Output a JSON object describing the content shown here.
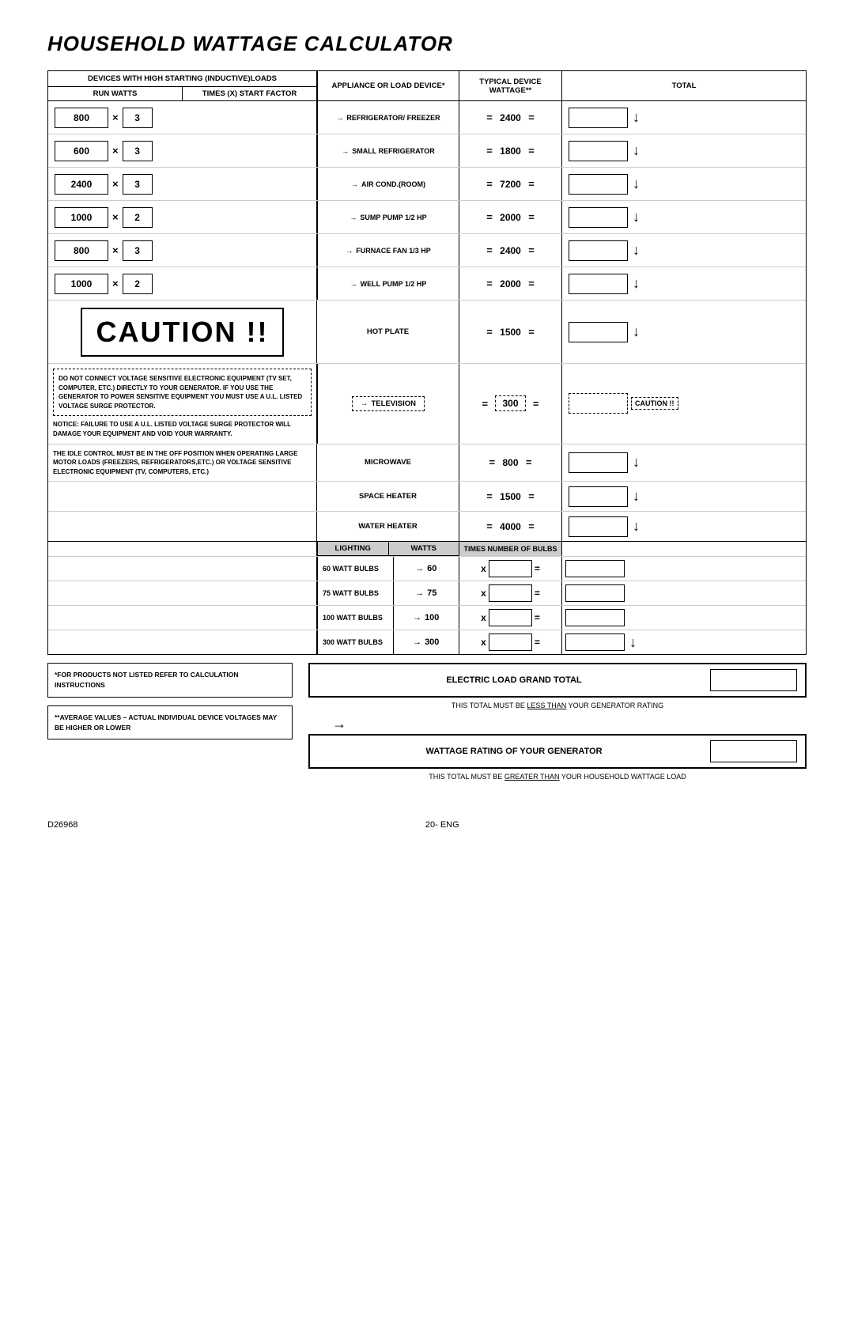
{
  "title": "HOUSEHOLD WATTAGE CALCULATOR",
  "headers": {
    "devices": "DEVICES WITH HIGH STARTING (INDUCTIVE)LOADS",
    "run_watts": "RUN WATTS",
    "start_factor": "TIMES (X) START FACTOR",
    "appliance": "APPLIANCE OR LOAD DEVICE*",
    "wattage": "TYPICAL DEVICE WATTAGE**",
    "total": "TOTAL"
  },
  "rows": [
    {
      "run_watts": "800",
      "start_factor": "3",
      "appliance": "REFRIGERATOR/ FREEZER",
      "wattage": "2400"
    },
    {
      "run_watts": "600",
      "start_factor": "3",
      "appliance": "SMALL REFRIGERATOR",
      "wattage": "1800"
    },
    {
      "run_watts": "2400",
      "start_factor": "3",
      "appliance": "AIR COND.(ROOM)",
      "wattage": "7200"
    },
    {
      "run_watts": "1000",
      "start_factor": "2",
      "appliance": "SUMP PUMP 1/2 HP",
      "wattage": "2000"
    },
    {
      "run_watts": "800",
      "start_factor": "3",
      "appliance": "FURNACE FAN 1/3 HP",
      "wattage": "2400"
    },
    {
      "run_watts": "1000",
      "start_factor": "2",
      "appliance": "WELL PUMP 1/2 HP",
      "wattage": "2000"
    }
  ],
  "caution_big": "CAUTION !!",
  "caution_text": "DO NOT CONNECT VOLTAGE SENSITIVE ELECTRONIC EQUIPMENT (TV SET, COMPUTER, ETC.) DIRECTLY TO YOUR GENERATOR. IF YOU USE THE GENERATOR TO POWER SENSITIVE EQUIPMENT YOU MUST USE A U.L. LISTED VOLTAGE SURGE PROTECTOR.",
  "notice_text": "NOTICE: FAILURE TO USE A U.L. LISTED VOLTAGE SURGE PROTECTOR WILL DAMAGE YOUR EQUIPMENT AND VOID YOUR WARRANTY.",
  "idle_text": "THE IDLE CONTROL MUST BE IN THE OFF POSITION WHEN OPERATING LARGE MOTOR LOADS (FREEZERS, REFRIGERATORS,ETC.) OR VOLTAGE SENSITIVE ELECTRONIC EQUIPMENT (TV, COMPUTERS, ETC.)",
  "non_inductive_rows": [
    {
      "appliance": "HOT PLATE",
      "wattage": "1500"
    },
    {
      "appliance": "TELEVISION",
      "wattage": "300",
      "dashed": true
    },
    {
      "appliance": "MICROWAVE",
      "wattage": "800"
    },
    {
      "appliance": "SPACE HEATER",
      "wattage": "1500"
    },
    {
      "appliance": "WATER HEATER",
      "wattage": "4000"
    }
  ],
  "caution_small": "CAUTION !!",
  "lighting": {
    "header1": "LIGHTING",
    "header2": "WATTS",
    "header3": "TIMES NUMBER OF BULBS",
    "rows": [
      {
        "label": "60 WATT BULBS",
        "watts": "60"
      },
      {
        "label": "75 WATT BULBS",
        "watts": "75"
      },
      {
        "label": "100 WATT BULBS",
        "watts": "100"
      },
      {
        "label": "300 WATT BULBS",
        "watts": "300"
      }
    ]
  },
  "footnote1_title": "*FOR PRODUCTS NOT LISTED REFER TO CALCULATION INSTRUCTIONS",
  "footnote2_title": "**AVERAGE VALUES – ACTUAL INDIVIDUAL DEVICE VOLTAGES MAY BE HIGHER OR LOWER",
  "grand_total_label": "ELECTRIC LOAD GRAND TOTAL",
  "grand_total_note1": "THIS TOTAL MUST BE",
  "grand_total_note1_underline": "LESS THAN",
  "grand_total_note1_end": "YOUR GENERATOR RATING",
  "wattage_rating_label": "WATTAGE RATING OF YOUR GENERATOR",
  "wattage_rating_note1": "THIS TOTAL MUST BE",
  "wattage_rating_note1_underline": "GREATER THAN",
  "wattage_rating_note1_end": "YOUR HOUSEHOLD WATTAGE LOAD",
  "footer_left": "D26968",
  "footer_center": "20- ENG"
}
